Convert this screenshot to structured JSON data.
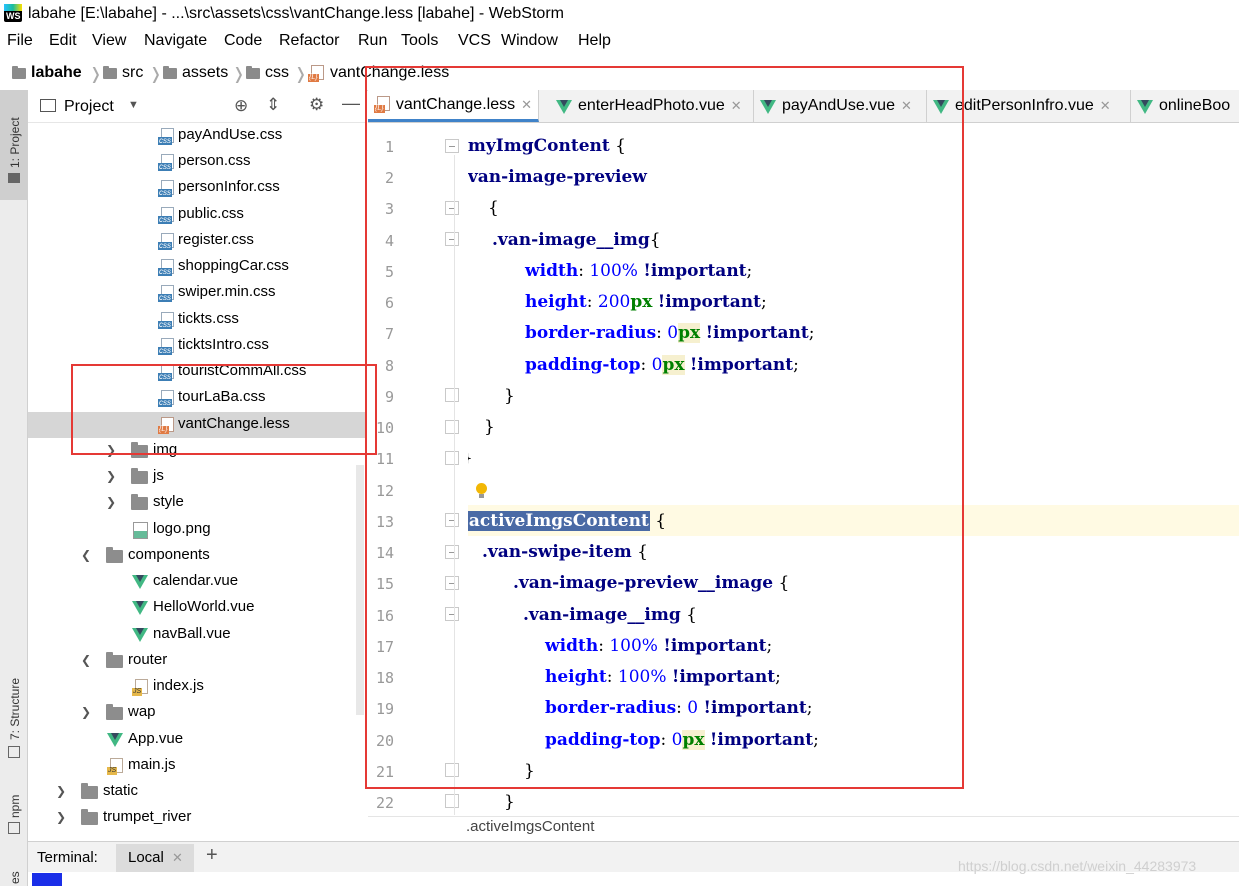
{
  "window": {
    "title": "labahe [E:\\labahe] - ...\\src\\assets\\css\\vantChange.less [labahe] - WebStorm",
    "app_icon": "WS"
  },
  "menu": [
    "File",
    "Edit",
    "View",
    "Navigate",
    "Code",
    "Refactor",
    "Run",
    "Tools",
    "VCS",
    "Window",
    "Help"
  ],
  "breadcrumb": [
    "labahe",
    "src",
    "assets",
    "css",
    "vantChange.less"
  ],
  "toolstrip": {
    "project": "1: Project",
    "structure": "7: Structure",
    "npm": "npm",
    "other": "es"
  },
  "project_panel": {
    "title": "Project"
  },
  "tree": [
    {
      "label": "payAndUse.css",
      "icon": "css-file-icon"
    },
    {
      "label": "person.css",
      "icon": "css-file-icon"
    },
    {
      "label": "personInfor.css",
      "icon": "css-file-icon"
    },
    {
      "label": "public.css",
      "icon": "css-file-icon"
    },
    {
      "label": "register.css",
      "icon": "css-file-icon"
    },
    {
      "label": "shoppingCar.css",
      "icon": "css-file-icon"
    },
    {
      "label": "swiper.min.css",
      "icon": "css-file-icon"
    },
    {
      "label": "tickts.css",
      "icon": "css-file-icon"
    },
    {
      "label": "ticktsIntro.css",
      "icon": "css-file-icon"
    },
    {
      "label": "touristCommAll.css",
      "icon": "css-file-icon"
    },
    {
      "label": "tourLaBa.css",
      "icon": "css-file-icon"
    },
    {
      "label": "vantChange.less",
      "icon": "less-file-icon",
      "selected": true
    },
    {
      "label": "img",
      "icon": "folder-icon",
      "chevron": "right"
    },
    {
      "label": "js",
      "icon": "folder-icon",
      "chevron": "right"
    },
    {
      "label": "style",
      "icon": "folder-icon",
      "chevron": "right"
    },
    {
      "label": "logo.png",
      "icon": "png-file-icon"
    },
    {
      "label": "components",
      "icon": "folder-icon",
      "chevron": "down"
    },
    {
      "label": "calendar.vue",
      "icon": "vue-file-icon"
    },
    {
      "label": "HelloWorld.vue",
      "icon": "vue-file-icon"
    },
    {
      "label": "navBall.vue",
      "icon": "vue-file-icon"
    },
    {
      "label": "router",
      "icon": "folder-icon",
      "chevron": "down"
    },
    {
      "label": "index.js",
      "icon": "js-file-icon"
    },
    {
      "label": "wap",
      "icon": "folder-icon",
      "chevron": "right"
    },
    {
      "label": "App.vue",
      "icon": "vue-file-icon"
    },
    {
      "label": "main.js",
      "icon": "js-file-icon"
    },
    {
      "label": "static",
      "icon": "folder-icon",
      "chevron": "right"
    },
    {
      "label": "trumpet_river",
      "icon": "folder-icon",
      "chevron": "right"
    }
  ],
  "tabs": [
    {
      "label": "vantChange.less",
      "icon": "less-file-icon",
      "active": true
    },
    {
      "label": "enterHeadPhoto.vue",
      "icon": "vue-file-icon"
    },
    {
      "label": "payAndUse.vue",
      "icon": "vue-file-icon"
    },
    {
      "label": "editPersonInfro.vue",
      "icon": "vue-file-icon"
    },
    {
      "label": "onlineBoo",
      "icon": "vue-file-icon"
    }
  ],
  "code_lines": [
    "1",
    "2",
    "3",
    "4",
    "5",
    "6",
    "7",
    "8",
    "9",
    "10",
    "11",
    "12",
    "13",
    "14",
    "15",
    "16",
    "17",
    "18",
    "19",
    "20",
    "21",
    "22"
  ],
  "code": {
    "l1_sel": ".myImgContent",
    "l1_rest": " {",
    "l2_sel": ".van-image-preview",
    "l3": "{",
    "l4_sel": ".van-image__img",
    "l4_rest": "{",
    "l5_prop": "width",
    "l5_num": "100%",
    "l5_imp": "!important",
    "l6_prop": "height",
    "l6_num": "200",
    "l6_unit": "px",
    "l6_imp": "!important",
    "l7_prop": "border-radius",
    "l7_num": "0",
    "l7_unit": "px",
    "l7_imp": "!important",
    "l8_prop": "padding-top",
    "l8_num": "0",
    "l8_unit": "px",
    "l8_imp": "!important",
    "l9": "}",
    "l10": "}",
    "l11": "}",
    "l13_dot": ".",
    "l13_sel": "activeImgsContent",
    "l13_rest": " {",
    "l14_sel": ".van-swipe-item",
    "l14_rest": " {",
    "l15_sel": ".van-image-preview__image",
    "l15_rest": " {",
    "l16_sel": ".van-image__img",
    "l16_rest": " {",
    "l17_prop": "width",
    "l17_num": "100%",
    "l17_imp": "!important",
    "l18_prop": "height",
    "l18_num": "100%",
    "l18_imp": "!important",
    "l19_prop": "border-radius",
    "l19_num": "0",
    "l19_imp": "!important",
    "l20_prop": "padding-top",
    "l20_num": "0",
    "l20_unit": "px",
    "l20_imp": "!important",
    "l21": "}",
    "l22": "}"
  },
  "status_breadcrumb": ".activeImgsContent",
  "terminal": {
    "label": "Terminal:",
    "tab": "Local",
    "add": "+"
  },
  "watermark": "https://blog.csdn.net/weixin_44283973",
  "colors": {
    "selector": "#000080",
    "property": "#0000ff",
    "unit": "#008000",
    "highlight_box": "#e53935",
    "caret_line": "#fffae3"
  }
}
